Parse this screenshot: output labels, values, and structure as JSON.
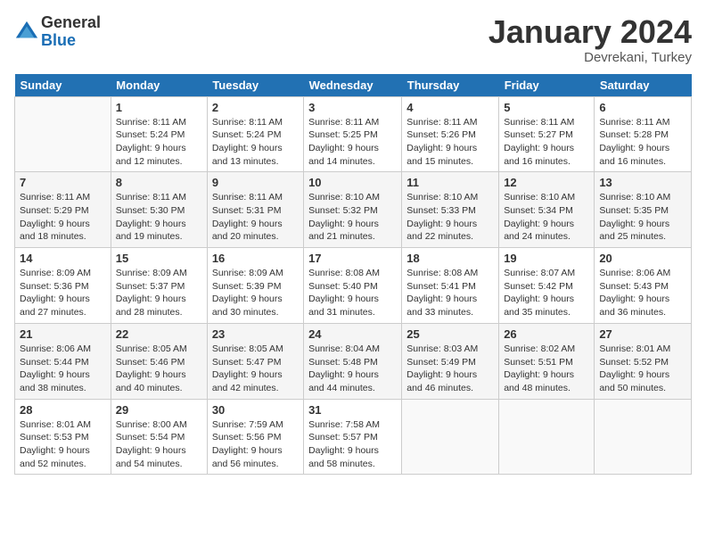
{
  "logo": {
    "general": "General",
    "blue": "Blue"
  },
  "title": "January 2024",
  "location": "Devrekani, Turkey",
  "days_header": [
    "Sunday",
    "Monday",
    "Tuesday",
    "Wednesday",
    "Thursday",
    "Friday",
    "Saturday"
  ],
  "weeks": [
    [
      {
        "day": "",
        "sunrise": "",
        "sunset": "",
        "daylight": ""
      },
      {
        "day": "1",
        "sunrise": "Sunrise: 8:11 AM",
        "sunset": "Sunset: 5:24 PM",
        "daylight": "Daylight: 9 hours and 12 minutes."
      },
      {
        "day": "2",
        "sunrise": "Sunrise: 8:11 AM",
        "sunset": "Sunset: 5:24 PM",
        "daylight": "Daylight: 9 hours and 13 minutes."
      },
      {
        "day": "3",
        "sunrise": "Sunrise: 8:11 AM",
        "sunset": "Sunset: 5:25 PM",
        "daylight": "Daylight: 9 hours and 14 minutes."
      },
      {
        "day": "4",
        "sunrise": "Sunrise: 8:11 AM",
        "sunset": "Sunset: 5:26 PM",
        "daylight": "Daylight: 9 hours and 15 minutes."
      },
      {
        "day": "5",
        "sunrise": "Sunrise: 8:11 AM",
        "sunset": "Sunset: 5:27 PM",
        "daylight": "Daylight: 9 hours and 16 minutes."
      },
      {
        "day": "6",
        "sunrise": "Sunrise: 8:11 AM",
        "sunset": "Sunset: 5:28 PM",
        "daylight": "Daylight: 9 hours and 16 minutes."
      }
    ],
    [
      {
        "day": "7",
        "sunrise": "Sunrise: 8:11 AM",
        "sunset": "Sunset: 5:29 PM",
        "daylight": "Daylight: 9 hours and 18 minutes."
      },
      {
        "day": "8",
        "sunrise": "Sunrise: 8:11 AM",
        "sunset": "Sunset: 5:30 PM",
        "daylight": "Daylight: 9 hours and 19 minutes."
      },
      {
        "day": "9",
        "sunrise": "Sunrise: 8:11 AM",
        "sunset": "Sunset: 5:31 PM",
        "daylight": "Daylight: 9 hours and 20 minutes."
      },
      {
        "day": "10",
        "sunrise": "Sunrise: 8:10 AM",
        "sunset": "Sunset: 5:32 PM",
        "daylight": "Daylight: 9 hours and 21 minutes."
      },
      {
        "day": "11",
        "sunrise": "Sunrise: 8:10 AM",
        "sunset": "Sunset: 5:33 PM",
        "daylight": "Daylight: 9 hours and 22 minutes."
      },
      {
        "day": "12",
        "sunrise": "Sunrise: 8:10 AM",
        "sunset": "Sunset: 5:34 PM",
        "daylight": "Daylight: 9 hours and 24 minutes."
      },
      {
        "day": "13",
        "sunrise": "Sunrise: 8:10 AM",
        "sunset": "Sunset: 5:35 PM",
        "daylight": "Daylight: 9 hours and 25 minutes."
      }
    ],
    [
      {
        "day": "14",
        "sunrise": "Sunrise: 8:09 AM",
        "sunset": "Sunset: 5:36 PM",
        "daylight": "Daylight: 9 hours and 27 minutes."
      },
      {
        "day": "15",
        "sunrise": "Sunrise: 8:09 AM",
        "sunset": "Sunset: 5:37 PM",
        "daylight": "Daylight: 9 hours and 28 minutes."
      },
      {
        "day": "16",
        "sunrise": "Sunrise: 8:09 AM",
        "sunset": "Sunset: 5:39 PM",
        "daylight": "Daylight: 9 hours and 30 minutes."
      },
      {
        "day": "17",
        "sunrise": "Sunrise: 8:08 AM",
        "sunset": "Sunset: 5:40 PM",
        "daylight": "Daylight: 9 hours and 31 minutes."
      },
      {
        "day": "18",
        "sunrise": "Sunrise: 8:08 AM",
        "sunset": "Sunset: 5:41 PM",
        "daylight": "Daylight: 9 hours and 33 minutes."
      },
      {
        "day": "19",
        "sunrise": "Sunrise: 8:07 AM",
        "sunset": "Sunset: 5:42 PM",
        "daylight": "Daylight: 9 hours and 35 minutes."
      },
      {
        "day": "20",
        "sunrise": "Sunrise: 8:06 AM",
        "sunset": "Sunset: 5:43 PM",
        "daylight": "Daylight: 9 hours and 36 minutes."
      }
    ],
    [
      {
        "day": "21",
        "sunrise": "Sunrise: 8:06 AM",
        "sunset": "Sunset: 5:44 PM",
        "daylight": "Daylight: 9 hours and 38 minutes."
      },
      {
        "day": "22",
        "sunrise": "Sunrise: 8:05 AM",
        "sunset": "Sunset: 5:46 PM",
        "daylight": "Daylight: 9 hours and 40 minutes."
      },
      {
        "day": "23",
        "sunrise": "Sunrise: 8:05 AM",
        "sunset": "Sunset: 5:47 PM",
        "daylight": "Daylight: 9 hours and 42 minutes."
      },
      {
        "day": "24",
        "sunrise": "Sunrise: 8:04 AM",
        "sunset": "Sunset: 5:48 PM",
        "daylight": "Daylight: 9 hours and 44 minutes."
      },
      {
        "day": "25",
        "sunrise": "Sunrise: 8:03 AM",
        "sunset": "Sunset: 5:49 PM",
        "daylight": "Daylight: 9 hours and 46 minutes."
      },
      {
        "day": "26",
        "sunrise": "Sunrise: 8:02 AM",
        "sunset": "Sunset: 5:51 PM",
        "daylight": "Daylight: 9 hours and 48 minutes."
      },
      {
        "day": "27",
        "sunrise": "Sunrise: 8:01 AM",
        "sunset": "Sunset: 5:52 PM",
        "daylight": "Daylight: 9 hours and 50 minutes."
      }
    ],
    [
      {
        "day": "28",
        "sunrise": "Sunrise: 8:01 AM",
        "sunset": "Sunset: 5:53 PM",
        "daylight": "Daylight: 9 hours and 52 minutes."
      },
      {
        "day": "29",
        "sunrise": "Sunrise: 8:00 AM",
        "sunset": "Sunset: 5:54 PM",
        "daylight": "Daylight: 9 hours and 54 minutes."
      },
      {
        "day": "30",
        "sunrise": "Sunrise: 7:59 AM",
        "sunset": "Sunset: 5:56 PM",
        "daylight": "Daylight: 9 hours and 56 minutes."
      },
      {
        "day": "31",
        "sunrise": "Sunrise: 7:58 AM",
        "sunset": "Sunset: 5:57 PM",
        "daylight": "Daylight: 9 hours and 58 minutes."
      },
      {
        "day": "",
        "sunrise": "",
        "sunset": "",
        "daylight": ""
      },
      {
        "day": "",
        "sunrise": "",
        "sunset": "",
        "daylight": ""
      },
      {
        "day": "",
        "sunrise": "",
        "sunset": "",
        "daylight": ""
      }
    ]
  ]
}
